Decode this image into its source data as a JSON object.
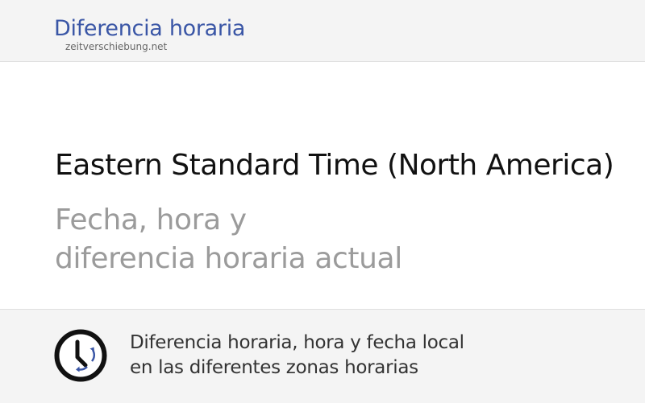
{
  "header": {
    "logo_title": "Diferencia horaria",
    "logo_subtitle": "zeitverschiebung.net"
  },
  "hero": {
    "title": "Eastern Standard Time (North America)",
    "subtitle_line1": "Fecha, hora y",
    "subtitle_line2": "diferencia horaria actual"
  },
  "footer": {
    "icon": "clock-icon",
    "line1": "Diferencia horaria, hora y fecha local",
    "line2": "en las diferentes zonas horarias"
  },
  "colors": {
    "brand": "#3a56a6",
    "muted_text": "#9b9b9b",
    "band_background": "#f4f4f4",
    "clock_arrows": "#3a56a6"
  }
}
